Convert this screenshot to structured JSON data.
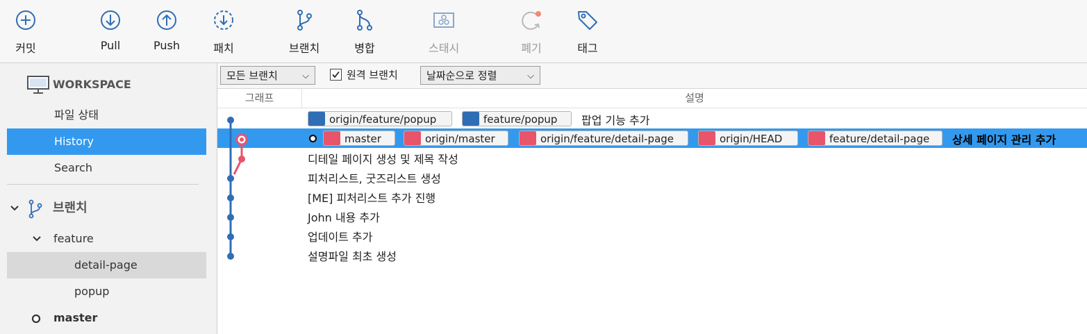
{
  "toolbar": {
    "commit": "커밋",
    "pull": "Pull",
    "push": "Push",
    "patch": "패치",
    "branch": "브랜치",
    "merge": "병합",
    "stash": "스태시",
    "discard": "폐기",
    "tag": "태그"
  },
  "sidebar": {
    "workspace": "WORKSPACE",
    "file_status": "파일 상태",
    "history": "History",
    "search": "Search",
    "branches": "브랜치",
    "feature": "feature",
    "detail_page": "detail-page",
    "popup": "popup",
    "master": "master"
  },
  "filter": {
    "all_branches": "모든 브랜치",
    "remote_branches": "원격 브랜치",
    "remote_checked": true,
    "sort": "날짜순으로 정렬"
  },
  "columns": {
    "graph": "그래프",
    "description": "설명"
  },
  "commits": [
    {
      "message": "팝업 기능 추가",
      "tags": [
        "origin/feature/popup",
        "feature/popup"
      ]
    },
    {
      "message": "상세 페이지 관리 추가",
      "tags": [
        "master",
        "origin/master",
        "origin/feature/detail-page",
        "origin/HEAD",
        "feature/detail-page"
      ]
    },
    {
      "message": "디테일 페이지 생성 및 제목 작성",
      "tags": []
    },
    {
      "message": "피처리스트, 굿즈리스트 생성",
      "tags": []
    },
    {
      "message": "[ME] 피처리스트 추가 진행",
      "tags": []
    },
    {
      "message": "John 내용 추가",
      "tags": []
    },
    {
      "message": "업데이트 추가",
      "tags": []
    },
    {
      "message": "설명파일 최초 생성",
      "tags": []
    }
  ],
  "colors": {
    "accent": "#3399ee",
    "branch_blue": "#2f6db5",
    "branch_red": "#e8546a"
  },
  "icons": [
    "commit-icon",
    "pull-icon",
    "push-icon",
    "patch-icon",
    "branch-icon",
    "merge-icon",
    "stash-icon",
    "discard-icon",
    "tag-icon",
    "monitor-icon",
    "branch-icon",
    "chevron-down-icon",
    "branch-badge-icon",
    "head-marker-icon"
  ]
}
